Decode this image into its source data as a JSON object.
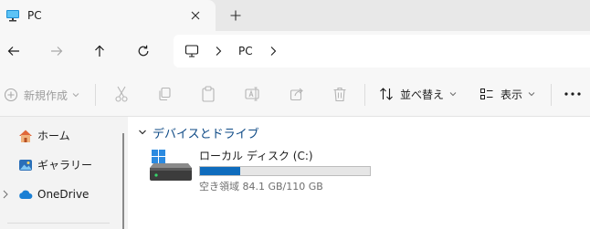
{
  "tab": {
    "title": "PC",
    "icon": "monitor-icon"
  },
  "nav": {
    "back": "arrow-left-icon",
    "forward": "arrow-right-icon",
    "up": "arrow-up-icon",
    "refresh": "refresh-icon"
  },
  "address": {
    "location": "PC"
  },
  "toolbar": {
    "new_label": "新規作成",
    "sort_label": "並べ替え",
    "view_label": "表示"
  },
  "sidebar": {
    "items": [
      {
        "label": "ホーム",
        "icon": "home-icon"
      },
      {
        "label": "ギャラリー",
        "icon": "gallery-icon"
      },
      {
        "label": "OneDrive",
        "icon": "cloud-icon"
      }
    ]
  },
  "content": {
    "group_label": "デバイスとドライブ",
    "drive": {
      "name": "ローカル ディスク (C:)",
      "space_text": "空き領域 84.1 GB/110 GB",
      "used_fraction": 0.235
    }
  },
  "colors": {
    "accent": "#0f6cbd",
    "group_header": "#0e4a86",
    "tab_icon": "#0e8fd6"
  }
}
